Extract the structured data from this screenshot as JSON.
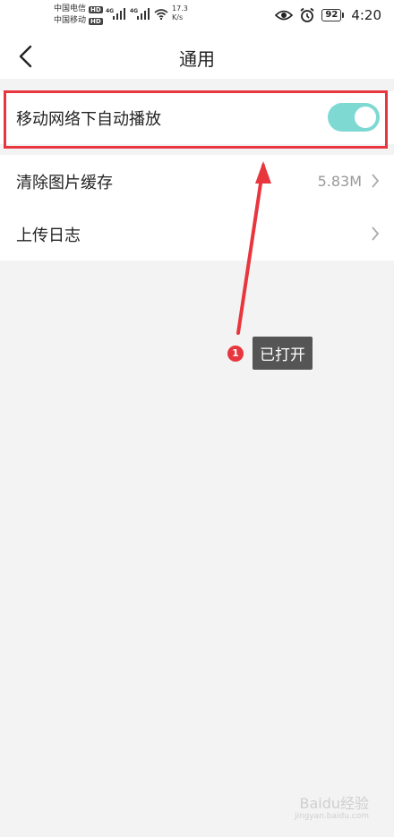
{
  "status_bar": {
    "carrier1": "中国电信",
    "carrier2": "中国移动",
    "hd": "HD",
    "net_type": "4G",
    "speed_value": "17.3",
    "speed_unit": "K/s",
    "battery": "92",
    "time": "4:20"
  },
  "header": {
    "title": "通用"
  },
  "settings": {
    "items": [
      {
        "label": "移动网络下自动播放",
        "toggle_on": true
      },
      {
        "label": "清除图片缓存",
        "value": "5.83M"
      },
      {
        "label": "上传日志"
      }
    ]
  },
  "annotation": {
    "number": "1",
    "label": "已打开",
    "color": "#e8363f"
  },
  "watermark": {
    "text": "Baidu经验",
    "url": "jingyan.baidu.com"
  },
  "colors": {
    "toggle_on": "#7ed9d3",
    "highlight": "#e8363f"
  }
}
